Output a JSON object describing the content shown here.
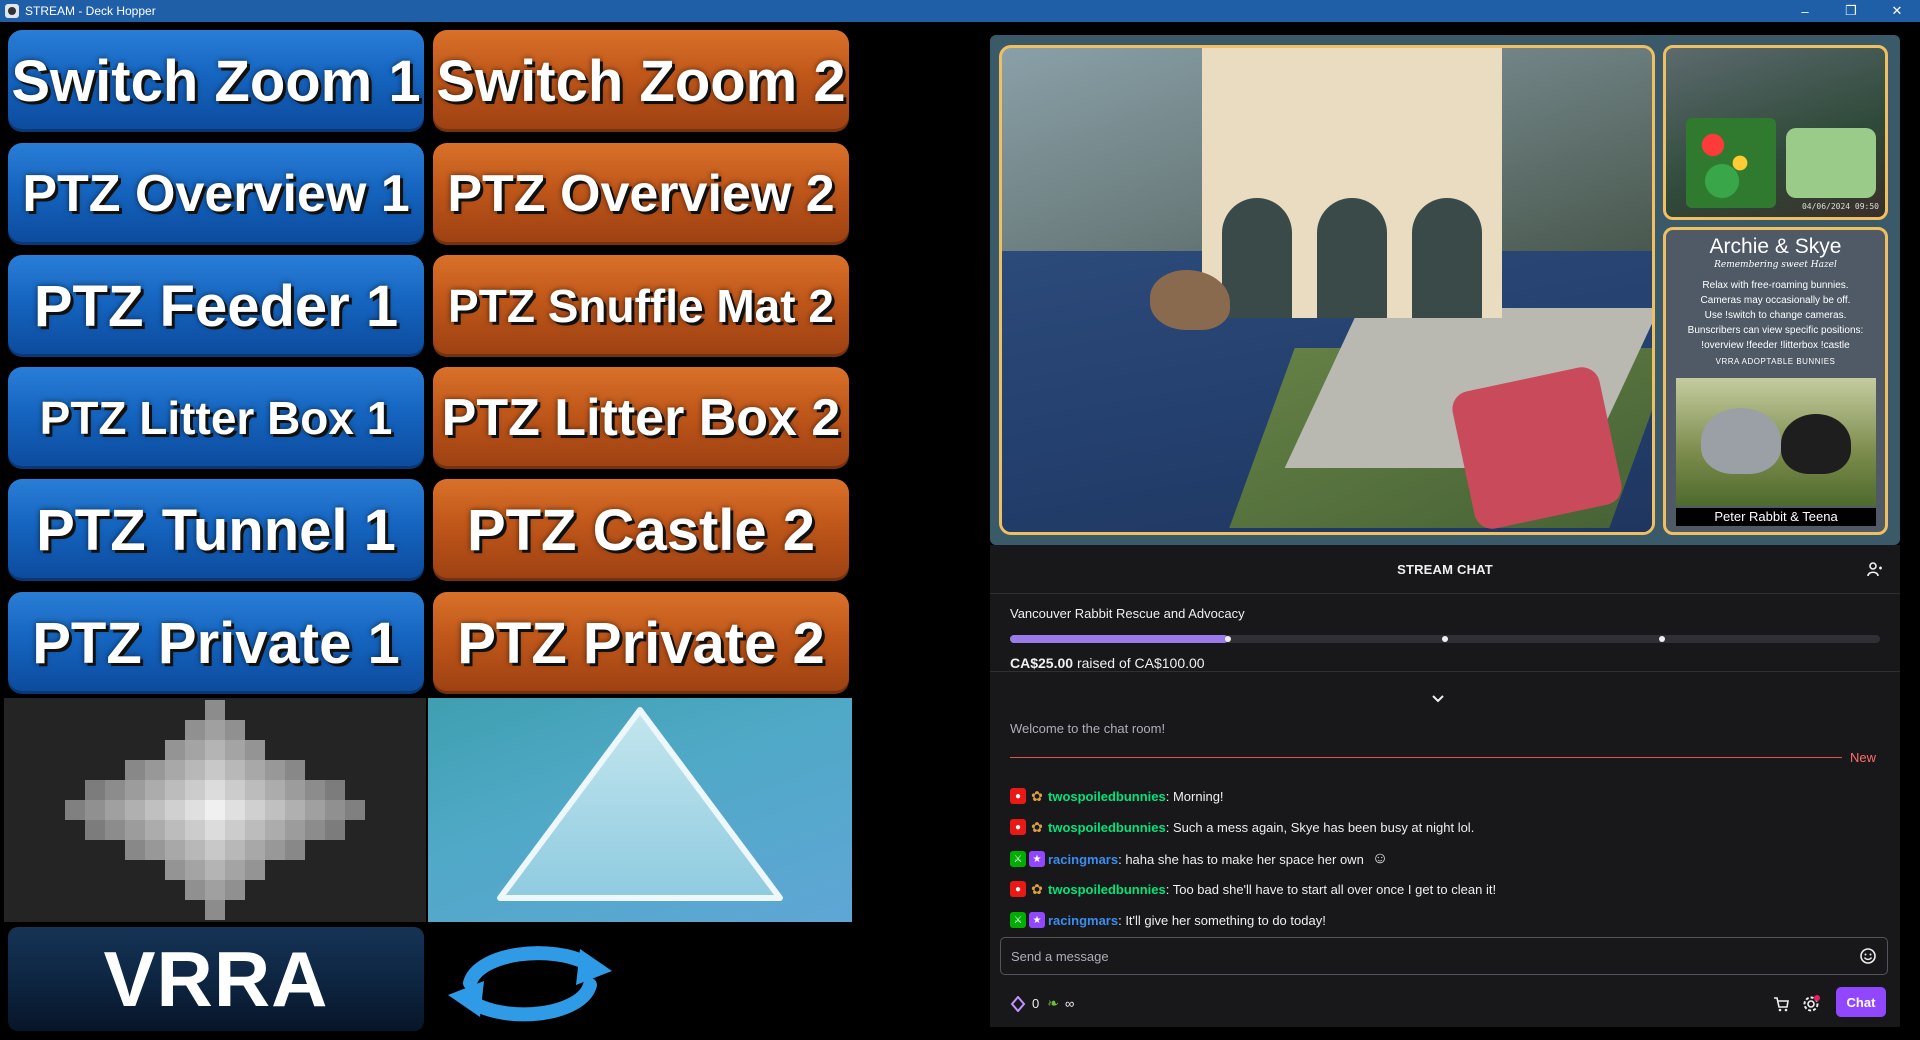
{
  "window": {
    "title": "STREAM - Deck Hopper",
    "controls": {
      "minimize": "–",
      "restore": "❐",
      "close": "✕"
    }
  },
  "deck": {
    "buttons": [
      {
        "label": "Switch Zoom 1",
        "color": "blue"
      },
      {
        "label": "Switch Zoom 2",
        "color": "orange"
      },
      {
        "label": "PTZ Overview 1",
        "color": "blue"
      },
      {
        "label": "PTZ Overview 2",
        "color": "orange"
      },
      {
        "label": "PTZ Feeder 1",
        "color": "blue"
      },
      {
        "label": "PTZ Snuffle Mat 2",
        "color": "orange"
      },
      {
        "label": "PTZ Litter Box 1",
        "color": "blue"
      },
      {
        "label": "PTZ Litter Box 2",
        "color": "orange"
      },
      {
        "label": "PTZ Tunnel 1",
        "color": "blue"
      },
      {
        "label": "PTZ Castle 2",
        "color": "orange"
      },
      {
        "label": "PTZ Private 1",
        "color": "blue"
      },
      {
        "label": "PTZ Private 2",
        "color": "orange"
      }
    ],
    "vrra_label": "VRRA",
    "tiles": {
      "pixel": "pixelated-light-icon",
      "triangle": "triangle-icon",
      "refresh": "refresh-arrows-icon"
    }
  },
  "stream": {
    "overlay": {
      "name": "Archie & Skye",
      "subtitle": "Remembering sweet Hazel",
      "lines": [
        "Relax with free-roaming bunnies.",
        "Cameras may occasionally be off.",
        "Use !switch to change cameras.",
        "Bunscribers can view specific positions:",
        "!overview !feeder !litterbox !castle"
      ],
      "adopt_title": "VRRA ADOPTABLE BUNNIES",
      "caption": "Peter Rabbit & Teena",
      "timestamp": "04/06/2024 09:50"
    }
  },
  "chat": {
    "header": "STREAM CHAT",
    "goal": {
      "org": "Vancouver Rabbit Rescue and Advocacy",
      "raised_amount": "CA$25.00",
      "raised_text": "raised of CA$100.00",
      "progress": 0.25
    },
    "welcome": "Welcome to the chat room!",
    "new_label": "New",
    "messages": [
      {
        "badges": [
          "rec",
          "flower"
        ],
        "user": "twospoiledbunnies",
        "color": "green",
        "text": ": Morning!"
      },
      {
        "badges": [
          "rec",
          "flower"
        ],
        "user": "twospoiledbunnies",
        "color": "green",
        "text": ": Such a mess again, Skye has been busy at night lol."
      },
      {
        "badges": [
          "mod",
          "sub"
        ],
        "user": "racingmars",
        "color": "blue",
        "text": ": haha she has to make her space her own"
      },
      {
        "badges": [
          "rec",
          "flower"
        ],
        "user": "twospoiledbunnies",
        "color": "green",
        "text": ": Too bad she'll have to start all over once I get to clean it!"
      },
      {
        "badges": [
          "mod",
          "sub"
        ],
        "user": "racingmars",
        "color": "blue",
        "text": ": It'll give her something to do today!"
      }
    ],
    "input_placeholder": "Send a message",
    "points": "0",
    "infinity": "∞",
    "chat_button": "Chat"
  }
}
